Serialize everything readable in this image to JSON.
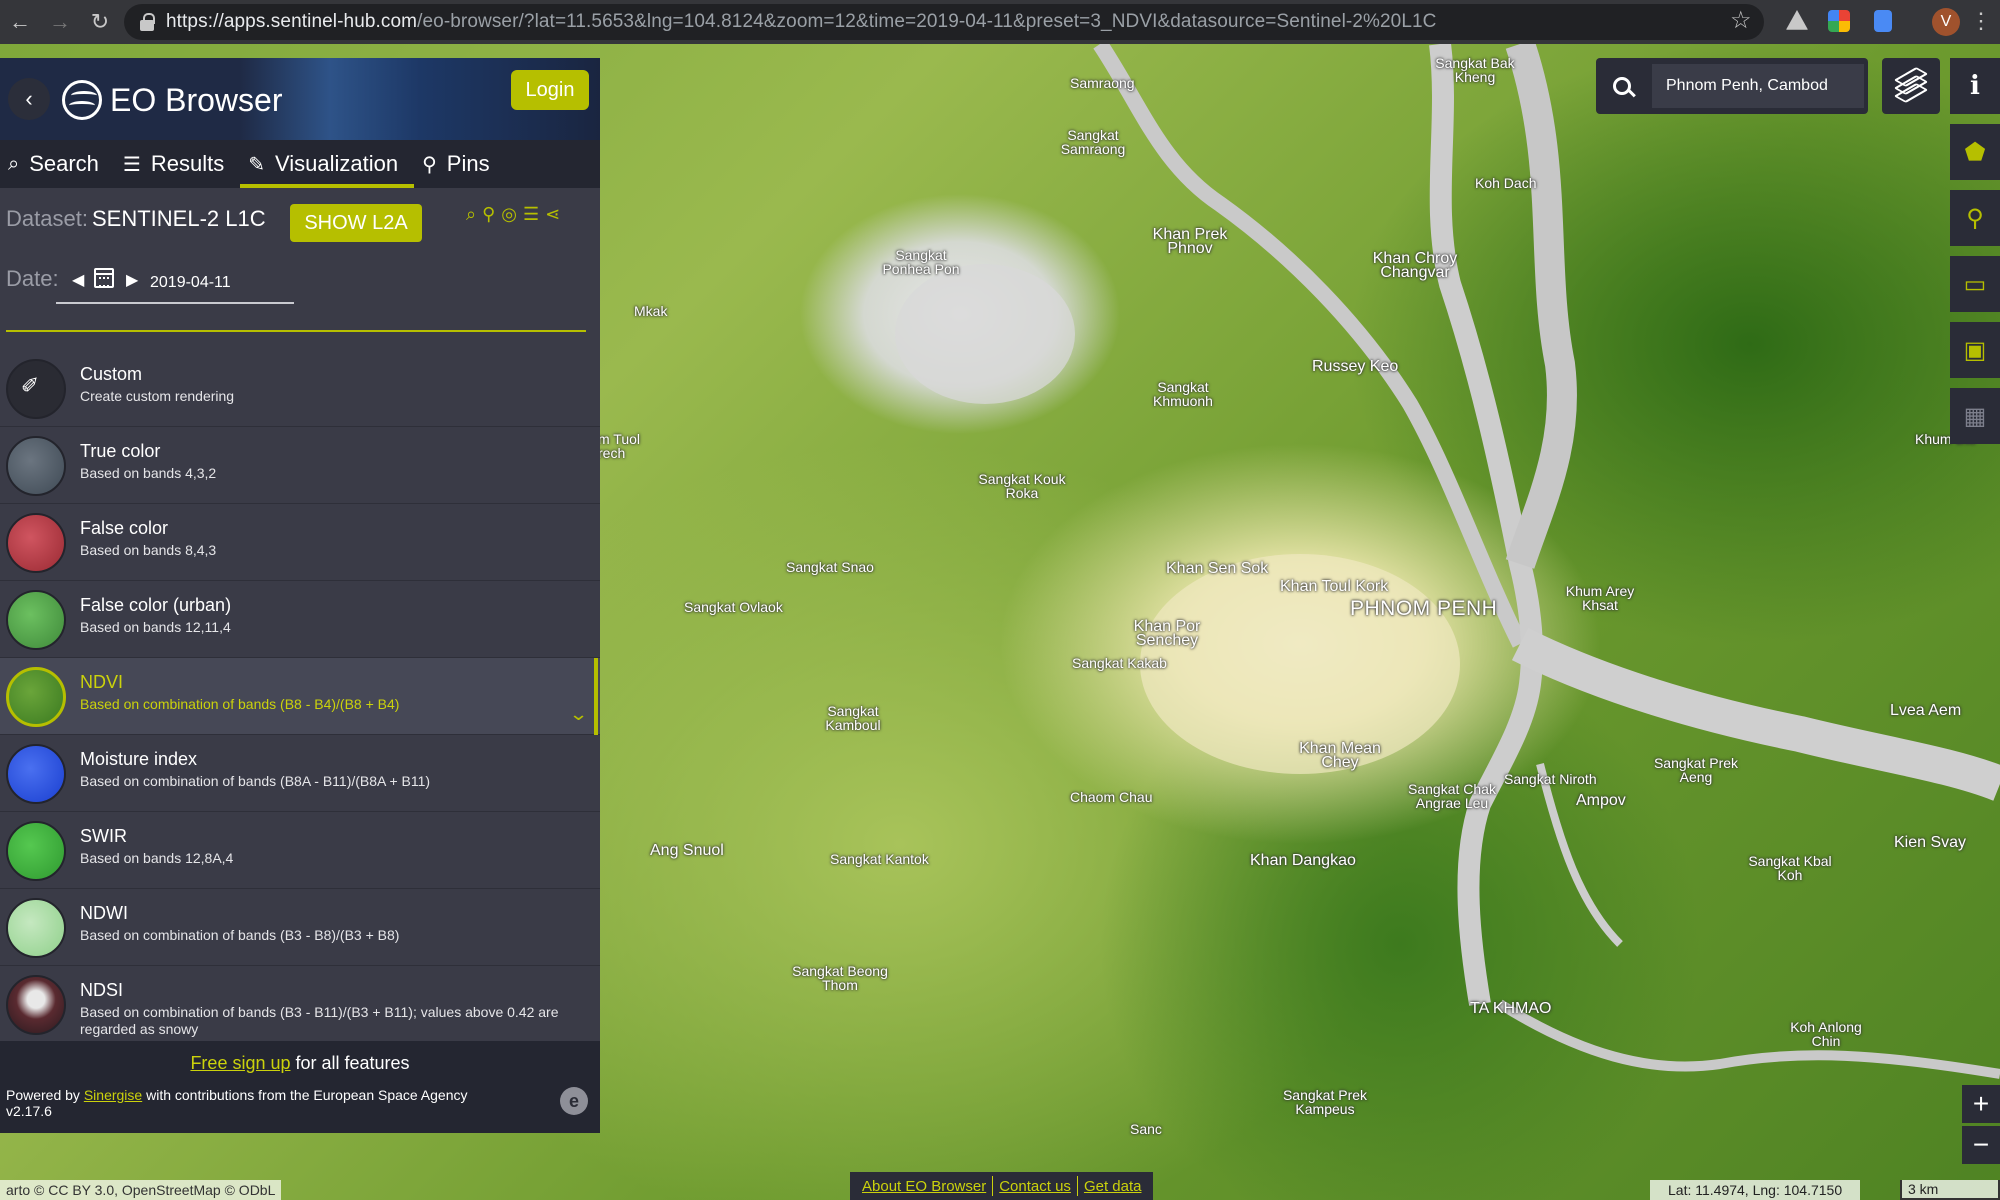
{
  "browser": {
    "url_host": "https://apps.sentinel-hub.com",
    "url_path": "/eo-browser/?lat=11.5653&lng=104.8124&zoom=12&time=2019-04-11&preset=3_NDVI&datasource=Sentinel-2%20L1C",
    "avatar_letter": "V"
  },
  "header": {
    "title": "EO Browser",
    "login_label": "Login"
  },
  "tabs": [
    {
      "label": "Search",
      "icon": "search-icon"
    },
    {
      "label": "Results",
      "icon": "list-icon"
    },
    {
      "label": "Visualization",
      "icon": "brush-icon",
      "active": true
    },
    {
      "label": "Pins",
      "icon": "pin-icon"
    }
  ],
  "dataset": {
    "label": "Dataset:",
    "value": "SENTINEL-2 L1C",
    "toggle_label": "SHOW L2A"
  },
  "date": {
    "label": "Date:",
    "value": "2019-04-11"
  },
  "presets": [
    {
      "title": "Custom",
      "desc": "Create custom rendering",
      "thumb": "#2a2b33"
    },
    {
      "title": "True color",
      "desc": "Based on bands 4,3,2",
      "thumb": "#3f4a55"
    },
    {
      "title": "False color",
      "desc": "Based on bands 8,4,3",
      "thumb": "#9a2a33"
    },
    {
      "title": "False color (urban)",
      "desc": "Based on bands 12,11,4",
      "thumb": "#3f8a3a"
    },
    {
      "title": "NDVI",
      "desc": "Based on combination of bands (B8 - B4)/(B8 + B4)",
      "thumb": "#3b7a20",
      "active": true
    },
    {
      "title": "Moisture index",
      "desc": "Based on combination of bands (B8A - B11)/(B8A + B11)",
      "thumb": "#1a3fd0"
    },
    {
      "title": "SWIR",
      "desc": "Based on bands 12,8A,4",
      "thumb": "#2f9a30"
    },
    {
      "title": "NDWI",
      "desc": "Based on combination of bands (B3 - B8)/(B3 + B8)",
      "thumb": "#8fd08a"
    },
    {
      "title": "NDSI",
      "desc": "Based on combination of bands (B3 - B11)/(B3 + B11); values above 0.42 are regarded as snowy",
      "thumb": "#5a2a30"
    }
  ],
  "footer": {
    "signup_link": "Free sign up",
    "signup_rest": " for all features",
    "powered_prefix": "Powered by ",
    "powered_link": "Sinergise",
    "powered_rest": " with contributions from the European Space Agency",
    "version": "v2.17.6"
  },
  "search": {
    "value": "Phnom Penh, Cambod"
  },
  "map_labels": [
    {
      "text": "Samraong"
    },
    {
      "text": "Sangkat Bak Kheng"
    },
    {
      "text": "Sangkat Samraong"
    },
    {
      "text": "Koh Dach"
    },
    {
      "text": "Khan Prek Phnov"
    },
    {
      "text": "Khan Chroy Changvar"
    },
    {
      "text": "Sangkat Ponhea Pon"
    },
    {
      "text": "Mkak"
    },
    {
      "text": "Russey Keo"
    },
    {
      "text": "Sangkat Khmuonh"
    },
    {
      "text": "m Tuol rech"
    },
    {
      "text": "Khum Bar"
    },
    {
      "text": "Sangkat Kouk Roka"
    },
    {
      "text": "Sangkat Snao"
    },
    {
      "text": "Khan Sen Sok"
    },
    {
      "text": "Khan Toul Kork"
    },
    {
      "text": "PHNOM PENH"
    },
    {
      "text": "Khum Arey Khsat"
    },
    {
      "text": "Sangkat Ovlaok"
    },
    {
      "text": "Khan Por Senchey"
    },
    {
      "text": "Sangkat Kakab"
    },
    {
      "text": "Sangkat Kamboul"
    },
    {
      "text": "Lvea Aem"
    },
    {
      "text": "Khan Mean Chey"
    },
    {
      "text": "Chaom Chau"
    },
    {
      "text": "Sangkat Chak Angrae Leu"
    },
    {
      "text": "Sangkat Niroth"
    },
    {
      "text": "Sangkat Prek Aeng"
    },
    {
      "text": "Ampov"
    },
    {
      "text": "Ang Snuol"
    },
    {
      "text": "Sangkat Kantok"
    },
    {
      "text": "Khan Dangkao"
    },
    {
      "text": "Kien Svay"
    },
    {
      "text": "Sangkat Kbal Koh"
    },
    {
      "text": "Sangkat Beong Thom"
    },
    {
      "text": "TA KHMAO"
    },
    {
      "text": "Koh Anlong Chin"
    },
    {
      "text": "Sangkat Prek Kampeus"
    },
    {
      "text": "Sanc"
    }
  ],
  "attribution": "arto © CC BY 3.0, OpenStreetMap © ODbL",
  "links": [
    "About EO Browser",
    "Contact us",
    "Get data"
  ],
  "coords": "Lat: 11.4974, Lng: 104.7150",
  "scale": "3 km"
}
